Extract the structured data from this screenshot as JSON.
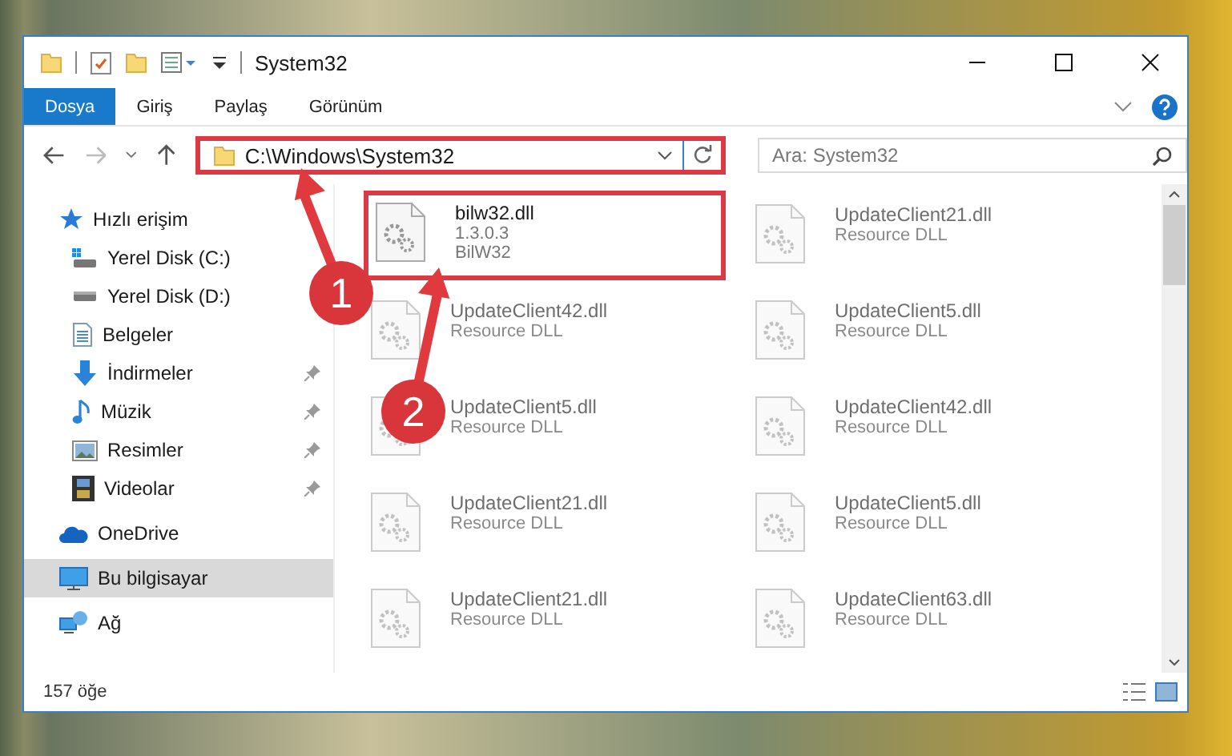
{
  "window": {
    "title": "System32"
  },
  "tabs": [
    {
      "label": "Dosya",
      "selected": true
    },
    {
      "label": "Giriş",
      "selected": false
    },
    {
      "label": "Paylaş",
      "selected": false
    },
    {
      "label": "Görünüm",
      "selected": false
    }
  ],
  "address": {
    "value": "C:\\Windows\\System32",
    "highlighted": true
  },
  "search": {
    "placeholder": "Ara: System32"
  },
  "sidebar": {
    "items": [
      {
        "label": "Hızlı erişim",
        "kind": "star",
        "selected": false,
        "children": [
          {
            "label": "Yerel Disk (C:)",
            "kind": "drive-c",
            "pinned": false,
            "selected": false
          },
          {
            "label": "Yerel Disk (D:)",
            "kind": "drive",
            "pinned": false,
            "selected": false
          },
          {
            "label": "Belgeler",
            "kind": "docs",
            "pinned": false,
            "selected": false
          },
          {
            "label": "İndirmeler",
            "kind": "download",
            "pinned": true,
            "selected": false
          },
          {
            "label": "Müzik",
            "kind": "music",
            "pinned": true,
            "selected": false
          },
          {
            "label": "Resimler",
            "kind": "pictures",
            "pinned": true,
            "selected": false
          },
          {
            "label": "Videolar",
            "kind": "video",
            "pinned": true,
            "selected": false
          }
        ]
      },
      {
        "label": "OneDrive",
        "kind": "cloud",
        "selected": false
      },
      {
        "label": "Bu bilgisayar",
        "kind": "pc",
        "selected": true
      },
      {
        "label": "Ağ",
        "kind": "network",
        "selected": false
      }
    ]
  },
  "files": [
    {
      "name": "bilw32.dll",
      "lines": [
        "1.3.0.3",
        "BilW32"
      ],
      "blurred": false,
      "highlighted": true
    },
    {
      "name": "UpdateClient21.dll",
      "lines": [
        "Resource DLL"
      ],
      "blurred": true,
      "highlighted": false
    },
    {
      "name": "UpdateClient42.dll",
      "lines": [
        "Resource DLL"
      ],
      "blurred": true,
      "highlighted": false
    },
    {
      "name": "UpdateClient5.dll",
      "lines": [
        "Resource DLL"
      ],
      "blurred": true,
      "highlighted": false
    },
    {
      "name": "UpdateClient5.dll",
      "lines": [
        "Resource DLL"
      ],
      "blurred": true,
      "highlighted": false
    },
    {
      "name": "UpdateClient42.dll",
      "lines": [
        "Resource DLL"
      ],
      "blurred": true,
      "highlighted": false
    },
    {
      "name": "UpdateClient21.dll",
      "lines": [
        "Resource DLL"
      ],
      "blurred": true,
      "highlighted": false
    },
    {
      "name": "UpdateClient5.dll",
      "lines": [
        "Resource DLL"
      ],
      "blurred": true,
      "highlighted": false
    },
    {
      "name": "UpdateClient21.dll",
      "lines": [
        "Resource DLL"
      ],
      "blurred": true,
      "highlighted": false
    },
    {
      "name": "UpdateClient63.dll",
      "lines": [
        "Resource DLL"
      ],
      "blurred": true,
      "highlighted": false
    }
  ],
  "status_bar": {
    "count": "157 öğe"
  },
  "annotations": [
    {
      "number": "1"
    },
    {
      "number": "2"
    }
  ]
}
